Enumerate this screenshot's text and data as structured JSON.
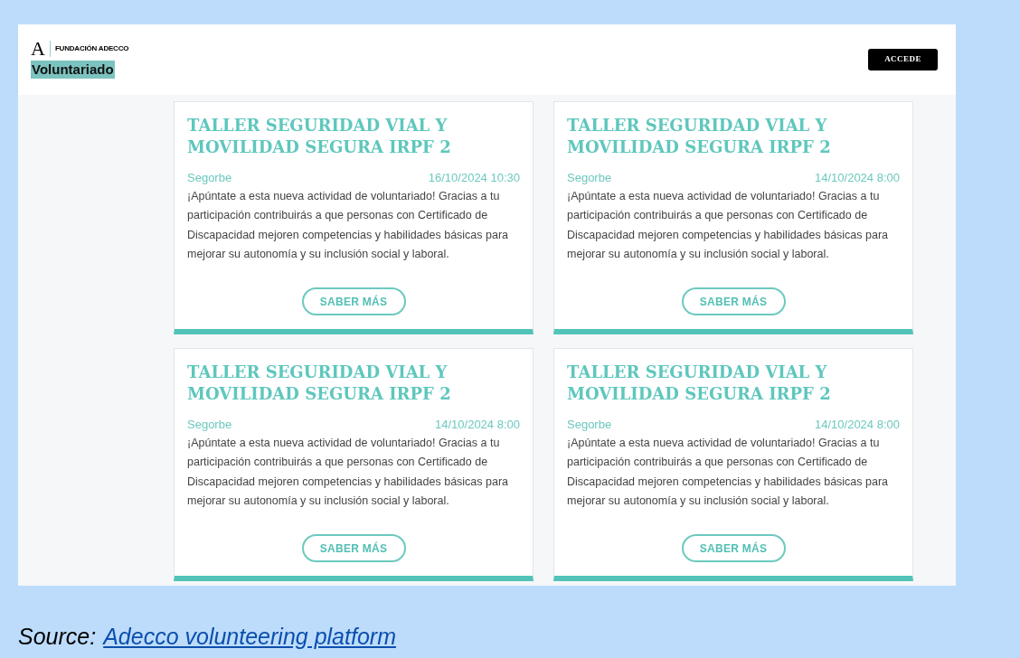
{
  "header": {
    "logo_letter": "A",
    "logo_text": "FUNDACIÓN ADECCO",
    "site_name": "Voluntariado",
    "login_button": "ACCEDE"
  },
  "cards": [
    {
      "title": "TALLER SEGURIDAD VIAL Y MOVILIDAD SEGURA IRPF 2",
      "location": "Segorbe",
      "datetime": "16/10/2024 10:30",
      "description": "¡Apúntate a esta nueva actividad de voluntariado! Gracias a tu participación contribuirás a que personas con Certificado de Discapacidad mejoren competencias y habilidades básicas para mejorar su autonomía y su inclusión social y laboral.",
      "button": "SABER MÁS"
    },
    {
      "title": "TALLER SEGURIDAD VIAL Y MOVILIDAD SEGURA IRPF 2",
      "location": "Segorbe",
      "datetime": "14/10/2024 8:00",
      "description": "¡Apúntate a esta nueva actividad de voluntariado! Gracias a tu participación contribuirás a que personas con Certificado de Discapacidad mejoren competencias y habilidades básicas para mejorar su autonomía y su inclusión social y laboral.",
      "button": "SABER MÁS"
    },
    {
      "title": "TALLER SEGURIDAD VIAL Y MOVILIDAD SEGURA IRPF 2",
      "location": "Segorbe",
      "datetime": "14/10/2024 8:00",
      "description": "¡Apúntate a esta nueva actividad de voluntariado! Gracias a tu participación contribuirás a que personas con Certificado de Discapacidad mejoren competencias y habilidades básicas para mejorar su autonomía y su inclusión social y laboral.",
      "button": "SABER MÁS"
    },
    {
      "title": "TALLER SEGURIDAD VIAL Y MOVILIDAD SEGURA IRPF 2",
      "location": "Segorbe",
      "datetime": "14/10/2024 8:00",
      "description": "¡Apúntate a esta nueva actividad de voluntariado! Gracias a tu participación contribuirás a que personas con Certificado de Discapacidad mejoren competencias y habilidades básicas para mejorar su autonomía y su inclusión social y laboral.",
      "button": "SABER MÁS"
    }
  ],
  "caption": {
    "label": "Source:",
    "link": "Adecco volunteering platform"
  }
}
